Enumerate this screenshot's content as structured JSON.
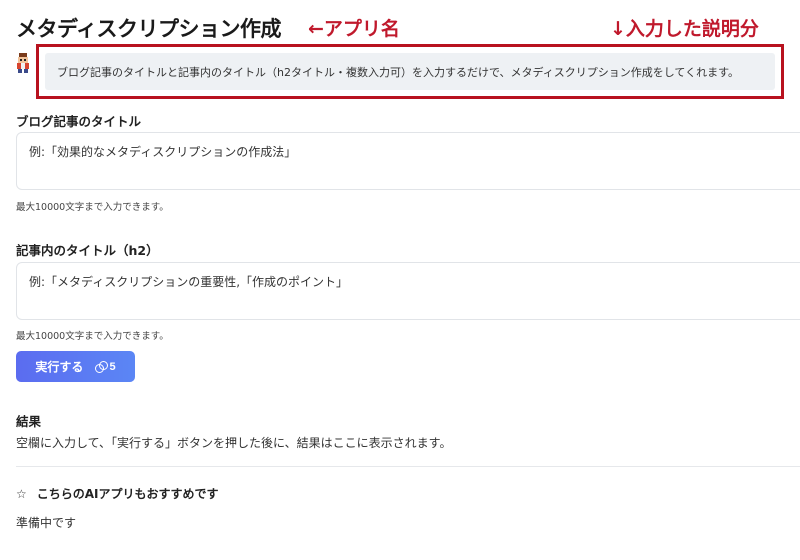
{
  "app": {
    "title": "メタディスクリプション作成",
    "description": "ブログ記事のタイトルと記事内のタイトル（h2タイトル・複数入力可）を入力するだけで、メタディスクリプション作成をしてくれます。"
  },
  "annotations": {
    "app_name": "←アプリ名",
    "description": "↓入力した説明分",
    "color": "#c0192c"
  },
  "form": {
    "blog_title": {
      "label": "ブログ記事のタイトル",
      "placeholder": "例:「効果的なメタディスクリプションの作成法」",
      "hint": "最大10000文字まで入力できます。"
    },
    "h2_title": {
      "label": "記事内のタイトル（h2）",
      "placeholder": "例:「メタディスクリプションの重要性,「作成のポイント」",
      "hint": "最大10000文字まで入力できます。"
    },
    "run_button": {
      "label": "実行する",
      "credits": "5",
      "icon": "coins-icon"
    }
  },
  "result": {
    "heading": "結果",
    "text": "空欄に入力して、「実行する」ボタンを押した後に、結果はここに表示されます。"
  },
  "recommend": {
    "icon": "star-icon",
    "heading": "こちらのAIアプリもおすすめです",
    "status": "準備中です"
  }
}
